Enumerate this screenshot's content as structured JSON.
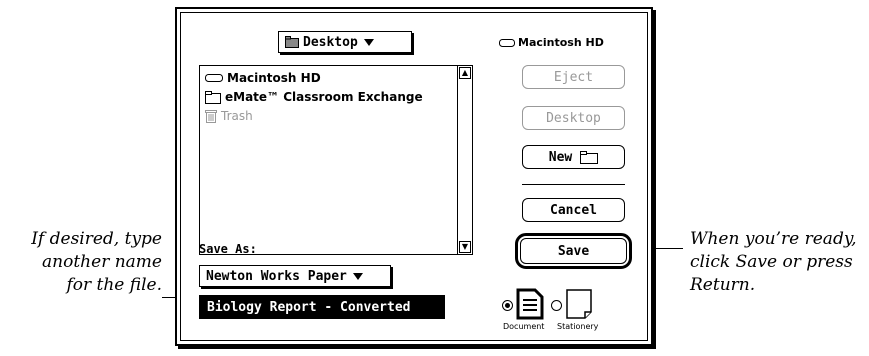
{
  "folder_popup": {
    "label": "Desktop",
    "icon": "folder-icon"
  },
  "volume_label": "Macintosh HD",
  "file_list": [
    {
      "label": "Macintosh HD",
      "icon": "hard-drive-icon",
      "dim": false
    },
    {
      "label": "eMate™ Classroom Exchange",
      "icon": "folder-icon",
      "dim": false
    },
    {
      "label": "Trash",
      "icon": "trash-icon",
      "dim": true
    }
  ],
  "buttons": {
    "eject": "Eject",
    "desktop": "Desktop",
    "new": "New",
    "cancel": "Cancel",
    "save": "Save"
  },
  "save_as_label": "Save As:",
  "format_popup": {
    "label": "Newton Works Paper"
  },
  "filename_value": "Biology Report - Converted",
  "file_type": {
    "document_label": "Document",
    "stationery_label": "Stationery",
    "selected": "Document"
  },
  "callouts": {
    "left_lines": [
      "If desired, type",
      "another name",
      "for the file."
    ],
    "right_lines": [
      "When you’re ready,",
      "click Save or press",
      "Return."
    ]
  }
}
